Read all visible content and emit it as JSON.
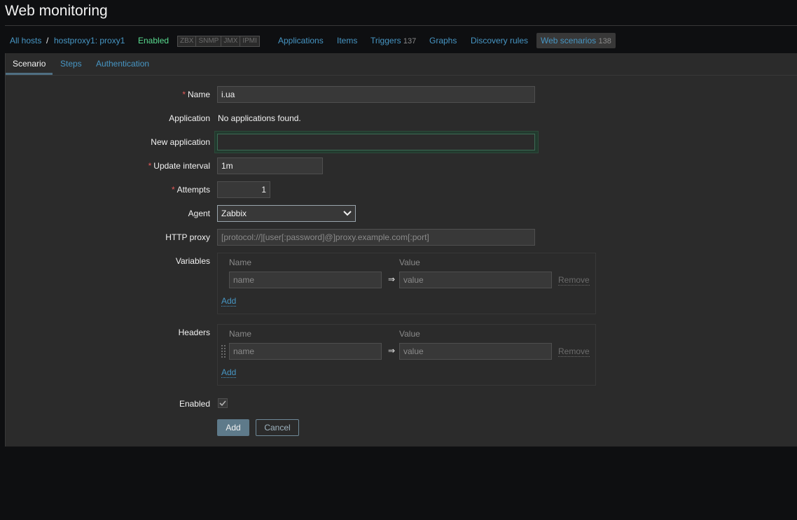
{
  "page": {
    "title": "Web monitoring"
  },
  "breadcrumb": {
    "all_hosts": "All hosts",
    "separator": "/",
    "host": "hostproxy1: proxy1",
    "status": "Enabled",
    "protocols": [
      "ZBX",
      "SNMP",
      "JMX",
      "IPMI"
    ],
    "applications": "Applications",
    "items": "Items",
    "triggers": "Triggers",
    "triggers_count": "137",
    "graphs": "Graphs",
    "discovery_rules": "Discovery rules",
    "web_scenarios": "Web scenarios",
    "web_scenarios_count": "138"
  },
  "tabs": [
    {
      "label": "Scenario",
      "active": true
    },
    {
      "label": "Steps",
      "active": false
    },
    {
      "label": "Authentication",
      "active": false
    }
  ],
  "form": {
    "name": {
      "label": "Name",
      "value": "i.ua",
      "required": true
    },
    "application": {
      "label": "Application",
      "value": "No applications found."
    },
    "new_application": {
      "label": "New application",
      "value": ""
    },
    "update_interval": {
      "label": "Update interval",
      "value": "1m",
      "required": true
    },
    "attempts": {
      "label": "Attempts",
      "value": "1",
      "required": true
    },
    "agent": {
      "label": "Agent",
      "selected": "Zabbix"
    },
    "http_proxy": {
      "label": "HTTP proxy",
      "placeholder": "[protocol://][user[:password]@]proxy.example.com[:port]"
    },
    "variables": {
      "label": "Variables",
      "col_name": "Name",
      "col_value": "Value",
      "rows": [
        {
          "name_placeholder": "name",
          "value_placeholder": "value",
          "remove": "Remove"
        }
      ],
      "add": "Add"
    },
    "headers": {
      "label": "Headers",
      "col_name": "Name",
      "col_value": "Value",
      "rows": [
        {
          "name_placeholder": "name",
          "value_placeholder": "value",
          "remove": "Remove"
        }
      ],
      "add": "Add"
    },
    "enabled": {
      "label": "Enabled",
      "checked": true
    },
    "buttons": {
      "add": "Add",
      "cancel": "Cancel"
    }
  },
  "icons": {
    "required": "asterisk",
    "arrow": "⇒",
    "checkbox": "check-icon",
    "drag": "drag-handle-icon"
  },
  "colors": {
    "accent": "#4796c4",
    "enabled": "#59db8f",
    "required": "#e45959",
    "primary_button": "#5e7a8a"
  }
}
